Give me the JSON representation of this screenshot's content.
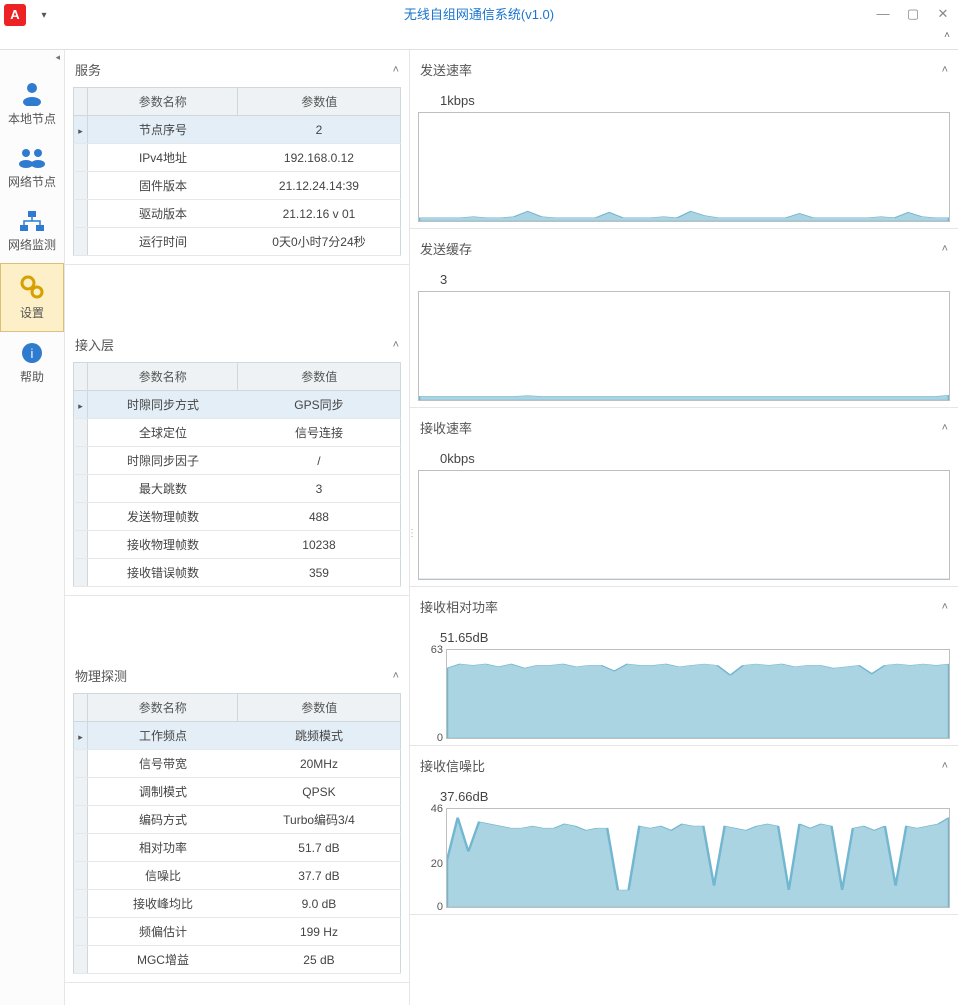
{
  "window": {
    "title": "无线自组网通信系统(v1.0)",
    "app_icon_letter": "A"
  },
  "sidebar": {
    "items": [
      {
        "label": "本地节点",
        "icon": "user-icon",
        "selected": false
      },
      {
        "label": "网络节点",
        "icon": "users-icon",
        "selected": false
      },
      {
        "label": "网络监测",
        "icon": "network-icon",
        "selected": false
      },
      {
        "label": "设置",
        "icon": "gears-icon",
        "selected": true
      },
      {
        "label": "帮助",
        "icon": "info-icon",
        "selected": false
      }
    ]
  },
  "tables": {
    "col_name": "参数名称",
    "col_value": "参数值",
    "service": {
      "title": "服务",
      "rows": [
        {
          "name": "节点序号",
          "value": "2",
          "sel": true
        },
        {
          "name": "IPv4地址",
          "value": "192.168.0.12"
        },
        {
          "name": "固件版本",
          "value": "21.12.24.14:39"
        },
        {
          "name": "驱动版本",
          "value": "21.12.16 v 01"
        },
        {
          "name": "运行时间",
          "value": "0天0小时7分24秒"
        }
      ]
    },
    "access": {
      "title": "接入层",
      "rows": [
        {
          "name": "时隙同步方式",
          "value": "GPS同步",
          "sel": true
        },
        {
          "name": "全球定位",
          "value": "信号连接"
        },
        {
          "name": "时隙同步因子",
          "value": "/"
        },
        {
          "name": "最大跳数",
          "value": "3"
        },
        {
          "name": "发送物理帧数",
          "value": "488"
        },
        {
          "name": "接收物理帧数",
          "value": "10238"
        },
        {
          "name": "接收错误帧数",
          "value": "359"
        }
      ]
    },
    "phy": {
      "title": "物理探测",
      "rows": [
        {
          "name": "工作频点",
          "value": "跳频模式",
          "sel": true
        },
        {
          "name": "信号带宽",
          "value": "20MHz"
        },
        {
          "name": "调制模式",
          "value": "QPSK"
        },
        {
          "name": "编码方式",
          "value": "Turbo编码3/4"
        },
        {
          "name": "相对功率",
          "value": "51.7 dB"
        },
        {
          "name": "信噪比",
          "value": "37.7 dB"
        },
        {
          "name": "接收峰均比",
          "value": "9.0 dB"
        },
        {
          "name": "频偏估计",
          "value": "199 Hz"
        },
        {
          "name": "MGC增益",
          "value": "25 dB"
        }
      ]
    }
  },
  "charts": {
    "tx_rate": {
      "title": "发送速率",
      "label": "1kbps"
    },
    "tx_buf": {
      "title": "发送缓存",
      "label": "3"
    },
    "rx_rate": {
      "title": "接收速率",
      "label": "0kbps"
    },
    "rx_power": {
      "title": "接收相对功率",
      "label": "51.65dB",
      "ymax": "63",
      "ymin": "0"
    },
    "rx_snr": {
      "title": "接收信噪比",
      "label": "37.66dB",
      "ymax": "46",
      "ymid": "20",
      "ymin": "0"
    }
  },
  "chart_data": [
    {
      "type": "area",
      "title": "发送速率",
      "ylabel": "kbps",
      "ylim": [
        0,
        1
      ],
      "current": 1,
      "values": [
        0.03,
        0.03,
        0.03,
        0.03,
        0.04,
        0.03,
        0.03,
        0.04,
        0.09,
        0.04,
        0.03,
        0.03,
        0.03,
        0.03,
        0.08,
        0.03,
        0.03,
        0.03,
        0.04,
        0.03,
        0.09,
        0.05,
        0.03,
        0.03,
        0.03,
        0.03,
        0.03,
        0.03,
        0.07,
        0.03,
        0.03,
        0.03,
        0.03,
        0.03,
        0.04,
        0.03,
        0.08,
        0.04,
        0.03,
        0.03
      ]
    },
    {
      "type": "area",
      "title": "发送缓存",
      "ylabel": "",
      "ylim": [
        0,
        3
      ],
      "current": 3,
      "values": [
        0.1,
        0.1,
        0.1,
        0.1,
        0.1,
        0.1,
        0.1,
        0.1,
        0.12,
        0.1,
        0.1,
        0.1,
        0.1,
        0.1,
        0.1,
        0.1,
        0.1,
        0.1,
        0.1,
        0.1,
        0.1,
        0.1,
        0.1,
        0.1,
        0.1,
        0.1,
        0.1,
        0.1,
        0.1,
        0.1,
        0.1,
        0.1,
        0.1,
        0.1,
        0.1,
        0.1,
        0.1,
        0.1,
        0.1,
        0.13
      ]
    },
    {
      "type": "area",
      "title": "接收速率",
      "ylabel": "kbps",
      "ylim": [
        0,
        1
      ],
      "current": 0,
      "values": [
        0,
        0,
        0,
        0,
        0,
        0,
        0,
        0,
        0,
        0,
        0,
        0,
        0,
        0,
        0,
        0,
        0,
        0,
        0,
        0,
        0,
        0,
        0,
        0,
        0,
        0,
        0,
        0,
        0,
        0,
        0,
        0,
        0,
        0,
        0,
        0,
        0,
        0,
        0,
        0
      ]
    },
    {
      "type": "area",
      "title": "接收相对功率",
      "ylabel": "dB",
      "ylim": [
        0,
        63
      ],
      "current": 51.65,
      "values": [
        50,
        53,
        52,
        53,
        51,
        53,
        50,
        52,
        52,
        53,
        51,
        52,
        52,
        48,
        53,
        52,
        52,
        53,
        51,
        52,
        53,
        52,
        45,
        52,
        53,
        52,
        53,
        51,
        52,
        52,
        50,
        51,
        52,
        46,
        52,
        53,
        52,
        53,
        52,
        53
      ]
    },
    {
      "type": "area",
      "title": "接收信噪比",
      "ylabel": "dB",
      "ylim": [
        0,
        46
      ],
      "current": 37.66,
      "values": [
        22,
        42,
        26,
        40,
        39,
        38,
        37,
        37,
        38,
        37,
        37,
        39,
        38,
        36,
        37,
        37,
        8,
        8,
        38,
        37,
        38,
        36,
        39,
        38,
        38,
        10,
        38,
        37,
        36,
        38,
        39,
        38,
        8,
        39,
        37,
        39,
        38,
        8,
        37,
        38,
        36,
        38,
        10,
        38,
        37,
        38,
        39,
        42
      ]
    }
  ]
}
